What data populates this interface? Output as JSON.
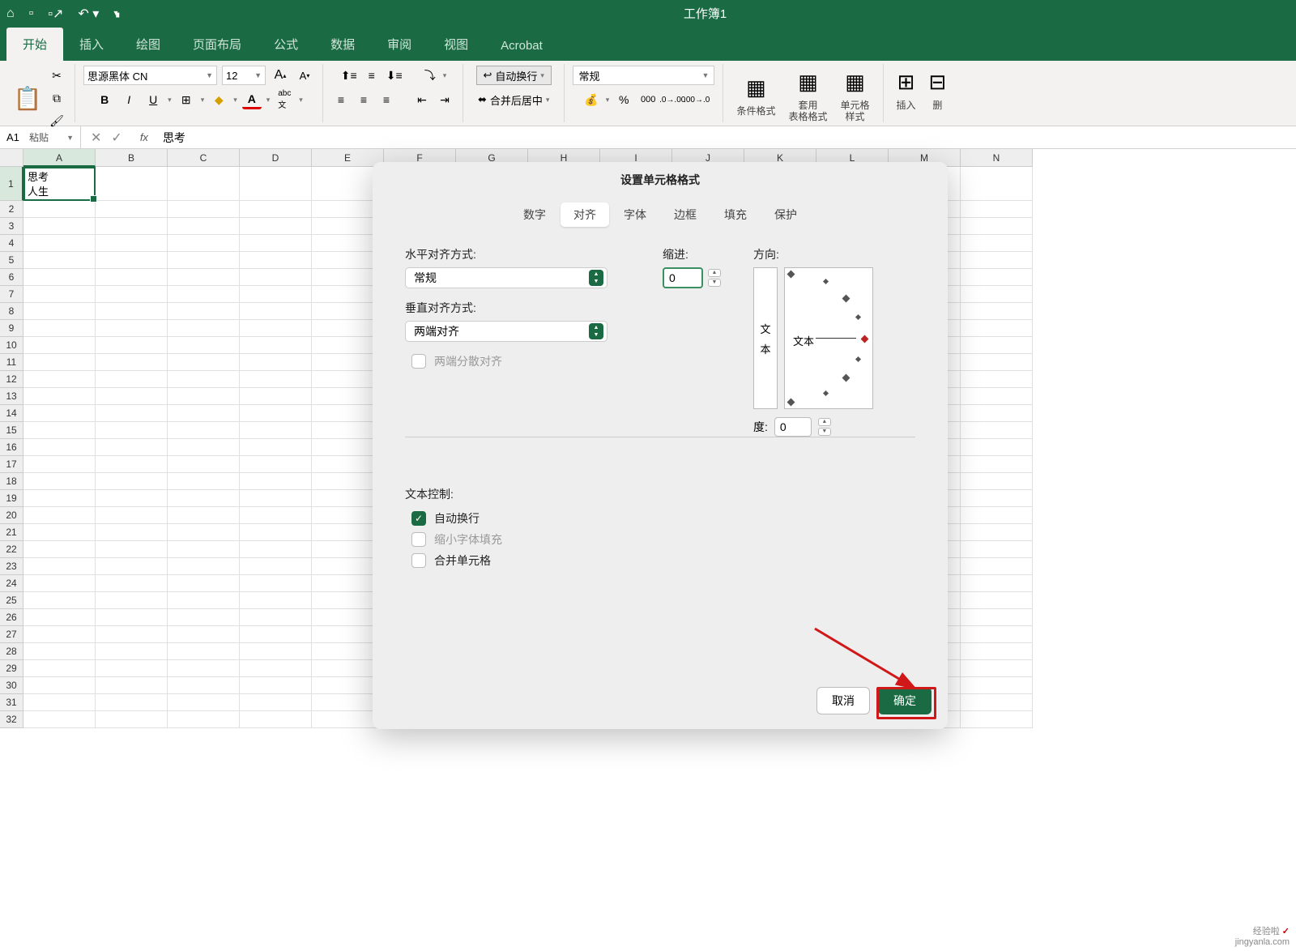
{
  "titlebar": {
    "title": "工作簿1"
  },
  "ribbon_tabs": [
    "开始",
    "插入",
    "绘图",
    "页面布局",
    "公式",
    "数据",
    "审阅",
    "视图",
    "Acrobat"
  ],
  "ribbon": {
    "paste": "粘贴",
    "font_name": "思源黑体 CN",
    "font_size": "12",
    "wrap_text": "自动换行",
    "merge_center": "合并后居中",
    "number_format": "常规",
    "cond_fmt": "条件格式",
    "table_fmt": "套用\n表格格式",
    "cell_style": "单元格\n样式",
    "insert": "插入",
    "delete": "删"
  },
  "formula": {
    "name_box": "A1",
    "value": "思考"
  },
  "columns": [
    "A",
    "B",
    "C",
    "D",
    "E",
    "F",
    "G",
    "H",
    "I",
    "J",
    "K",
    "L",
    "M",
    "N"
  ],
  "cell_a1": "思考\n人生",
  "dialog": {
    "title": "设置单元格格式",
    "tabs": [
      "数字",
      "对齐",
      "字体",
      "边框",
      "填充",
      "保护"
    ],
    "active_tab": "对齐",
    "h_align_label": "水平对齐方式:",
    "h_align_value": "常规",
    "v_align_label": "垂直对齐方式:",
    "v_align_value": "两端对齐",
    "justify_dist": "两端分散对齐",
    "indent_label": "缩进:",
    "indent_value": "0",
    "orientation_label": "方向:",
    "orient_v_text": "文本",
    "orient_h_text": "文本",
    "degree_label": "度:",
    "degree_value": "0",
    "text_control_label": "文本控制:",
    "wrap_text": "自动换行",
    "shrink_fit": "缩小字体填充",
    "merge_cells": "合并单元格",
    "cancel": "取消",
    "ok": "确定"
  },
  "watermark": {
    "line1": "经验啦",
    "line2": "jingyanla.com"
  }
}
